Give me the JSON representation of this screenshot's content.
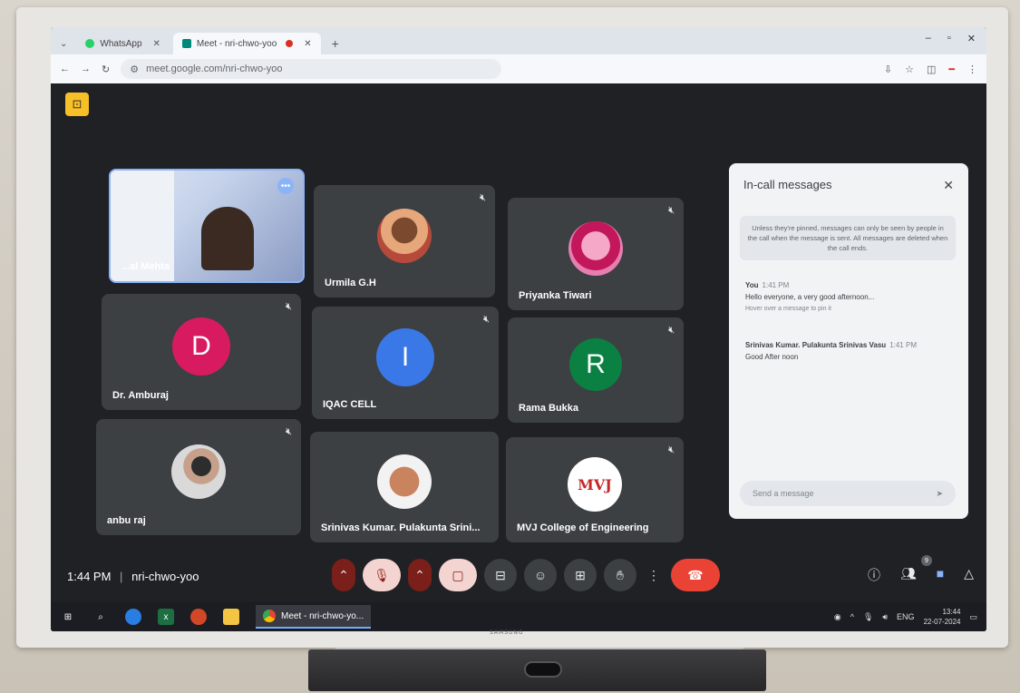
{
  "browser": {
    "tabs": [
      {
        "label": "WhatsApp",
        "active": false
      },
      {
        "label": "Meet - nri-chwo-yoo",
        "active": true
      }
    ],
    "url": "meet.google.com/nri-chwo-yoo"
  },
  "tiles": [
    {
      "name": "...al Mehta",
      "type": "video"
    },
    {
      "name": "Urmila G.H",
      "type": "photo"
    },
    {
      "name": "Priyanka Tiwari",
      "type": "photo"
    },
    {
      "name": "Dr. Amburaj",
      "type": "initial",
      "initial": "D",
      "color": "#d81b60"
    },
    {
      "name": "IQAC CELL",
      "type": "initial",
      "initial": "I",
      "color": "#3b78e7"
    },
    {
      "name": "Rama Bukka",
      "type": "initial",
      "initial": "R",
      "color": "#0b8043"
    },
    {
      "name": "anbu raj",
      "type": "photo"
    },
    {
      "name": "Srinivas Kumar. Pulakunta Srini...",
      "type": "photo"
    },
    {
      "name": "MVJ College of Engineering",
      "type": "logo",
      "logo_text": "MVJ"
    }
  ],
  "chat": {
    "title": "In-call messages",
    "info": "Unless they're pinned, messages can only be seen by people in the call when the message is sent. All messages are deleted when the call ends.",
    "messages": [
      {
        "sender": "You",
        "time": "1:41 PM",
        "text": "Hello everyone, a very good afternoon...",
        "hint": "Hover over a message to pin it"
      },
      {
        "sender": "Srinivas Kumar. Pulakunta Srinivas Vasu",
        "time": "1:41 PM",
        "text": "Good After noon"
      }
    ],
    "input_placeholder": "Send a message"
  },
  "meeting": {
    "time": "1:44 PM",
    "code": "nri-chwo-yoo",
    "people_count": "9"
  },
  "taskbar": {
    "chrome_label": "Meet - nri-chwo-yo...",
    "lang": "ENG",
    "time": "13:44",
    "date": "22-07-2024"
  },
  "tv_brand": "SAMSUNG"
}
